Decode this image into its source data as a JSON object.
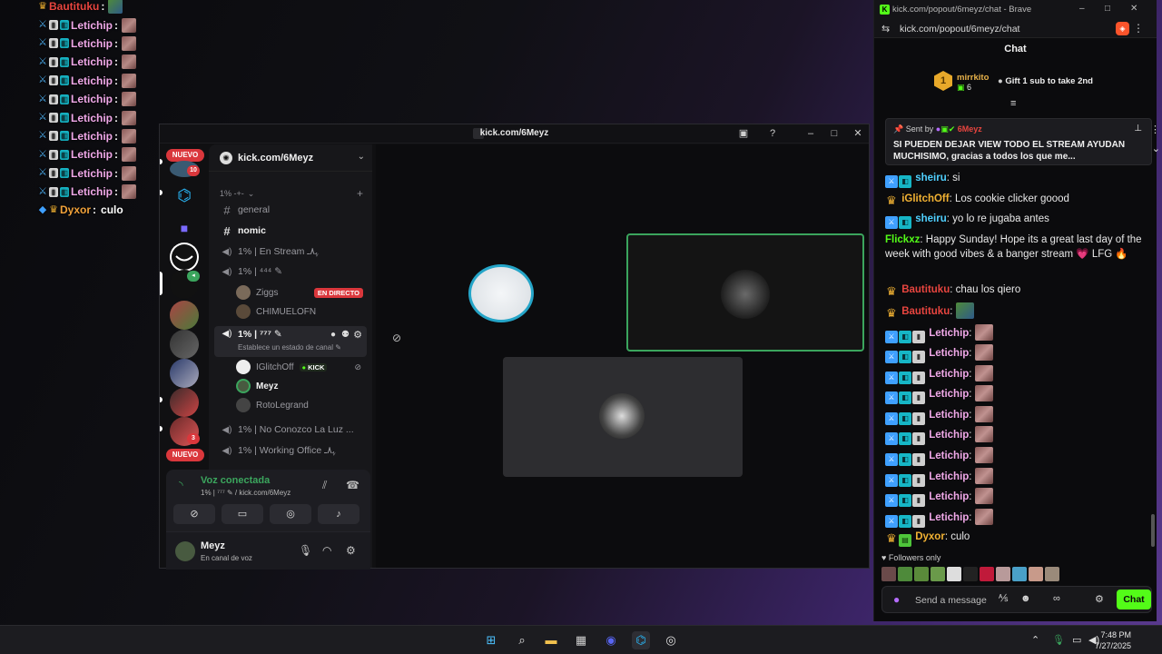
{
  "overlay": {
    "lines": [
      {
        "user": "Bautituku",
        "colon": ":",
        "msg": ""
      },
      {
        "user": "Letichip",
        "colon": ":",
        "msg": ""
      },
      {
        "user": "Letichip",
        "colon": ":",
        "msg": ""
      },
      {
        "user": "Letichip",
        "colon": ":",
        "msg": ""
      },
      {
        "user": "Letichip",
        "colon": ":",
        "msg": ""
      },
      {
        "user": "Letichip",
        "colon": ":",
        "msg": ""
      },
      {
        "user": "Letichip",
        "colon": ":",
        "msg": ""
      },
      {
        "user": "Letichip",
        "colon": ":",
        "msg": ""
      },
      {
        "user": "Letichip",
        "colon": ":",
        "msg": ""
      },
      {
        "user": "Letichip",
        "colon": ":",
        "msg": ""
      },
      {
        "user": "Letichip",
        "colon": ":",
        "msg": ""
      },
      {
        "user": "Dyxor",
        "colon": ":",
        "msg": "culo"
      }
    ]
  },
  "discord": {
    "window_title": "kick.com/6Meyz",
    "server_name": "kick.com/6Meyz",
    "servers": {
      "new_top": "NUEVO",
      "badge_10": "10",
      "badge_3": "3",
      "new_bottom": "NUEVO"
    },
    "category": "1% ‑+‑",
    "channels": {
      "general": "general",
      "nomic": "nomic",
      "en_stream": "1% | En Stream ﮩ٨ـ",
      "c444": "1% | ⁴⁴⁴ ✎",
      "c777": "1% | ⁷⁷⁷ ✎",
      "c777_sub": "Establece un estado de canal ✎",
      "no_conozco": "1% | No Conozco La Luz ...",
      "working": "1% | Working Office ﮩ٨ـ"
    },
    "voice_users_a": [
      {
        "name": "Ziggs",
        "badge": "EN DIRECTO"
      },
      {
        "name": "CHIMUELOFN",
        "badge": ""
      }
    ],
    "voice_users_b": [
      {
        "name": "IGlitchOff",
        "badge": "KICK"
      },
      {
        "name": "Meyz",
        "badge": ""
      },
      {
        "name": "RotoLegrand",
        "badge": ""
      }
    ],
    "voice_panel": {
      "title": "Voz conectada",
      "subtitle": "1% | ⁷⁷⁷ ✎ / kick.com/6Meyz"
    },
    "user_panel": {
      "name": "Meyz",
      "status": "En canal de voz"
    }
  },
  "kick": {
    "window_title": "kick.com/popout/6meyz/chat - Brave",
    "url": "kick.com/popout/6meyz/chat",
    "chat_header": "Chat",
    "leader": {
      "rank": "1",
      "user": "mirrkito",
      "count": "6",
      "gift_text": "Gift 1 sub to take 2nd"
    },
    "pinned": {
      "sent_by": "Sent by",
      "sender": "6Meyz",
      "message": "SI PUEDEN DEJAR VIEW TODO EL STREAM AYUDAN MUCHISIMO, gracias a todos los que me..."
    },
    "messages": [
      {
        "user": "sheiru",
        "text": " si"
      },
      {
        "user": "iGlitchOff",
        "text": " Los cookie clicker goood"
      },
      {
        "user": "sheiru",
        "text": " yo lo re jugaba antes"
      },
      {
        "user": "Flickxz",
        "text": " Happy Sunday! Hope its a great last day of the week with good vibes & a banger stream 💗 LFG 🔥"
      },
      {
        "user": "Bautituku",
        "text": " chau los qiero"
      },
      {
        "user": "Bautituku",
        "text": ""
      },
      {
        "user": "Letichip",
        "text": ""
      },
      {
        "user": "Letichip",
        "text": ""
      },
      {
        "user": "Letichip",
        "text": ""
      },
      {
        "user": "Letichip",
        "text": ""
      },
      {
        "user": "Letichip",
        "text": ""
      },
      {
        "user": "Letichip",
        "text": ""
      },
      {
        "user": "Letichip",
        "text": ""
      },
      {
        "user": "Letichip",
        "text": ""
      },
      {
        "user": "Letichip",
        "text": ""
      },
      {
        "user": "Letichip",
        "text": ""
      },
      {
        "user": "Dyxor",
        "text": " culo"
      }
    ],
    "followers_only": "Followers only",
    "send_placeholder": "Send a message",
    "chat_button": "Chat"
  },
  "taskbar": {
    "time": "7:48 PM",
    "date": "7/27/2025"
  },
  "colors": {
    "kick_green": "#53fc18",
    "discord_red": "#da373c",
    "voice_green": "#3ba55d"
  }
}
